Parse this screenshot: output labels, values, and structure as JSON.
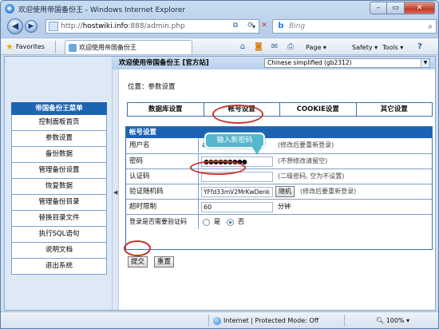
{
  "window": {
    "title": "欢迎使用帝国备份王 - Windows Internet Explorer",
    "minimize": "–",
    "maximize": "▭",
    "close": "✕"
  },
  "nav": {
    "url_prefix": "http://",
    "url_host": "hostwiki.info",
    "url_path": ":888/admin.php",
    "search_placeholder": "Bing"
  },
  "favbar": {
    "favorites_label": "Favorites",
    "tab_title": "欢迎使用帝国备份王",
    "page_menu": "Page ▾",
    "safety_menu": "Safety ▾",
    "tools_menu": "Tools ▾",
    "help_icon": "?"
  },
  "header": {
    "title": "欢迎使用帝国备份王 [官方站]",
    "language": "Chinese simplified (gb2312)"
  },
  "sidebar": {
    "title": "帝国备份王菜单",
    "items": [
      "控制面板首页",
      "参数设置",
      "备份数据",
      "管理备份设置",
      "恢复数据",
      "管理备份目录",
      "替换目录文件",
      "执行SQL语句",
      "说明文档",
      "退出系统"
    ]
  },
  "main": {
    "position": "位置：参数设置",
    "tabs": [
      "数据库设置",
      "帐号设置",
      "COOKIE设置",
      "其它设置"
    ],
    "form_title": "帐号设置",
    "rows": {
      "username": {
        "label": "用户名",
        "value": "admin",
        "note": "(修改后要重新登录)"
      },
      "password": {
        "label": "密码",
        "value": "●●●●●●●●●",
        "note": "(不想修改请留空)"
      },
      "auth_code": {
        "label": "认证码",
        "value": "",
        "note": "(二级密码, 空为不设置)"
      },
      "random_code": {
        "label": "验证随机码",
        "value": "YFfd33mV2MrKwDenk",
        "button": "随机",
        "note": "(修改后要重新登录)"
      },
      "timeout": {
        "label": "超时限制",
        "value": "60",
        "unit": "分钟"
      },
      "need_captcha": {
        "label": "登录是否需要验证码",
        "yes": "是",
        "no": "否",
        "selected": "否"
      }
    },
    "submit": "提交",
    "reset": "重置",
    "callout": "输入新密码"
  },
  "status": {
    "zone": "Internet | Protected Mode: Off",
    "zoom": "100%"
  },
  "colors": {
    "accent": "#1c63b4",
    "annotation_ring": "#c8312b",
    "callout": "#55b6cc"
  }
}
